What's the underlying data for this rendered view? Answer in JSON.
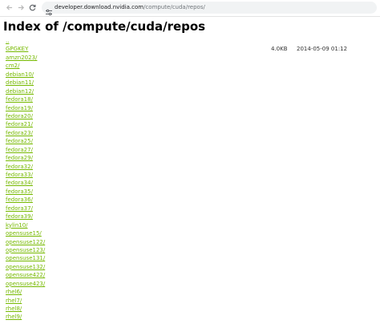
{
  "browser": {
    "url_host": "developer.download.nvidia.com",
    "url_path": "/compute/cuda/repos/"
  },
  "page": {
    "title": "Index of /compute/cuda/repos"
  },
  "theme": {
    "link_color": "#76b900"
  },
  "entries": [
    {
      "name": "..",
      "size": "",
      "date": ""
    },
    {
      "name": "GPGKEY",
      "size": "4.0KB",
      "date": "2014-05-09 01:12"
    },
    {
      "name": "amzn2023/",
      "size": "",
      "date": ""
    },
    {
      "name": "cm2/",
      "size": "",
      "date": ""
    },
    {
      "name": "debian10/",
      "size": "",
      "date": ""
    },
    {
      "name": "debian11/",
      "size": "",
      "date": ""
    },
    {
      "name": "debian12/",
      "size": "",
      "date": ""
    },
    {
      "name": "fedora18/",
      "size": "",
      "date": ""
    },
    {
      "name": "fedora19/",
      "size": "",
      "date": ""
    },
    {
      "name": "fedora20/",
      "size": "",
      "date": ""
    },
    {
      "name": "fedora21/",
      "size": "",
      "date": ""
    },
    {
      "name": "fedora23/",
      "size": "",
      "date": ""
    },
    {
      "name": "fedora25/",
      "size": "",
      "date": ""
    },
    {
      "name": "fedora27/",
      "size": "",
      "date": ""
    },
    {
      "name": "fedora29/",
      "size": "",
      "date": ""
    },
    {
      "name": "fedora32/",
      "size": "",
      "date": ""
    },
    {
      "name": "fedora33/",
      "size": "",
      "date": ""
    },
    {
      "name": "fedora34/",
      "size": "",
      "date": ""
    },
    {
      "name": "fedora35/",
      "size": "",
      "date": ""
    },
    {
      "name": "fedora36/",
      "size": "",
      "date": ""
    },
    {
      "name": "fedora37/",
      "size": "",
      "date": ""
    },
    {
      "name": "fedora39/",
      "size": "",
      "date": ""
    },
    {
      "name": "kylin10/",
      "size": "",
      "date": ""
    },
    {
      "name": "opensuse15/",
      "size": "",
      "date": ""
    },
    {
      "name": "opensuse122/",
      "size": "",
      "date": ""
    },
    {
      "name": "opensuse123/",
      "size": "",
      "date": ""
    },
    {
      "name": "opensuse131/",
      "size": "",
      "date": ""
    },
    {
      "name": "opensuse132/",
      "size": "",
      "date": ""
    },
    {
      "name": "opensuse422/",
      "size": "",
      "date": ""
    },
    {
      "name": "opensuse423/",
      "size": "",
      "date": ""
    },
    {
      "name": "rhel6/",
      "size": "",
      "date": ""
    },
    {
      "name": "rhel7/",
      "size": "",
      "date": ""
    },
    {
      "name": "rhel8/",
      "size": "",
      "date": ""
    },
    {
      "name": "rhel9/",
      "size": "",
      "date": ""
    }
  ]
}
